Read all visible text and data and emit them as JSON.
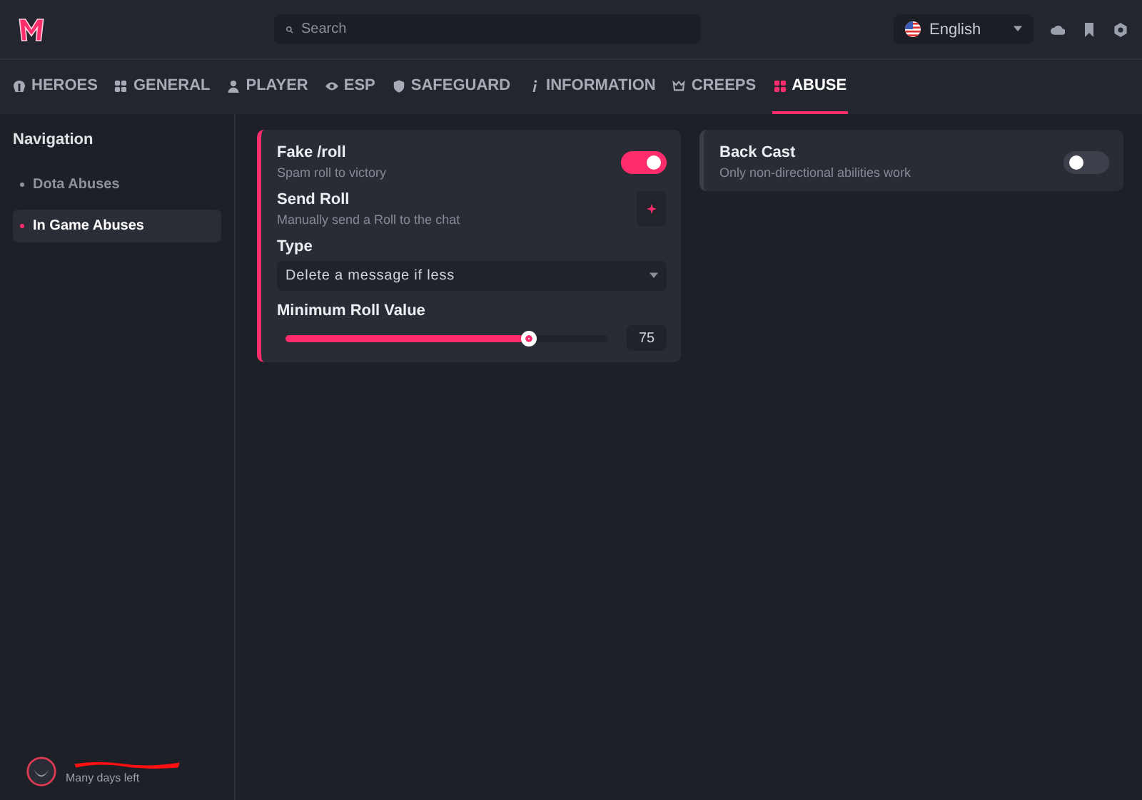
{
  "search": {
    "placeholder": "Search"
  },
  "language": {
    "value": "English"
  },
  "tabs": [
    {
      "label": "HEROES",
      "selected": false
    },
    {
      "label": "GENERAL",
      "selected": false
    },
    {
      "label": "PLAYER",
      "selected": false
    },
    {
      "label": "ESP",
      "selected": false
    },
    {
      "label": "SAFEGUARD",
      "selected": false
    },
    {
      "label": "INFORMATION",
      "selected": false
    },
    {
      "label": "CREEPS",
      "selected": false
    },
    {
      "label": "ABUSE",
      "selected": true
    }
  ],
  "sidebar": {
    "title": "Navigation",
    "items": [
      {
        "label": "Dota Abuses",
        "selected": false
      },
      {
        "label": "In Game Abuses",
        "selected": true
      }
    ]
  },
  "cards": [
    {
      "rows": [
        {
          "kind": "toggle",
          "title": "Fake /roll",
          "description": "Spam roll to victory",
          "on": true
        },
        {
          "kind": "button",
          "title": "Send Roll",
          "description": "Manually send a Roll to the chat"
        },
        {
          "kind": "dropdown",
          "title": "Type",
          "value": "Delete a message if less"
        },
        {
          "kind": "slider",
          "title": "Minimum Roll Value",
          "level": 0.75,
          "reading": "75"
        }
      ]
    },
    {
      "rows": [
        {
          "kind": "toggle",
          "title": "Back Cast",
          "description": "Only non-directional abilities work",
          "on": false
        }
      ]
    }
  ],
  "user": {
    "status": "Many days left"
  }
}
